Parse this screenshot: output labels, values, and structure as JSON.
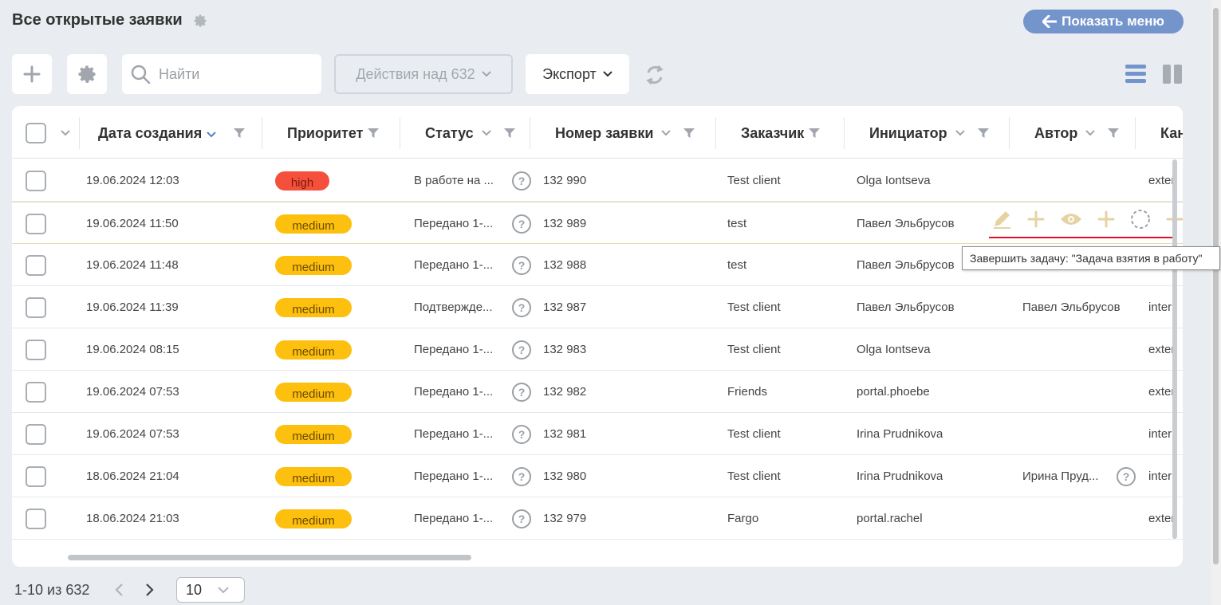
{
  "header": {
    "title": "Все открытые заявки",
    "show_menu_label": "Показать меню"
  },
  "toolbar": {
    "search_placeholder": "Найти",
    "actions_label": "Действия над 632",
    "export_label": "Экспорт"
  },
  "table": {
    "columns": [
      {
        "label": "Дата создания"
      },
      {
        "label": "Приоритет"
      },
      {
        "label": "Статус"
      },
      {
        "label": "Номер заявки"
      },
      {
        "label": "Заказчик"
      },
      {
        "label": "Инициатор"
      },
      {
        "label": "Автор"
      },
      {
        "label": "Кан"
      }
    ],
    "rows": [
      {
        "date": "19.06.2024 12:03",
        "priority": "high",
        "status": "В работе на ...",
        "number": "132 990",
        "client": "Test client",
        "initiator": "Olga Iontseva",
        "author": "",
        "channel": "exter"
      },
      {
        "date": "19.06.2024 11:50",
        "priority": "medium",
        "status": "Передано 1-...",
        "number": "132 989",
        "client": "test",
        "initiator": "Павел Эльбрусов",
        "author": "",
        "channel": ""
      },
      {
        "date": "19.06.2024 11:48",
        "priority": "medium",
        "status": "Передано 1-...",
        "number": "132 988",
        "client": "test",
        "initiator": "Павел Эльбрусов",
        "author": "",
        "channel": ""
      },
      {
        "date": "19.06.2024 11:39",
        "priority": "medium",
        "status": "Подтвержде...",
        "number": "132 987",
        "client": "Test client",
        "initiator": "Павел Эльбрусов",
        "author": "Павел Эльбрусов",
        "channel": "interr"
      },
      {
        "date": "19.06.2024 08:15",
        "priority": "medium",
        "status": "Передано 1-...",
        "number": "132 983",
        "client": "Test client",
        "initiator": "Olga Iontseva",
        "author": "",
        "channel": "exter"
      },
      {
        "date": "19.06.2024 07:53",
        "priority": "medium",
        "status": "Передано 1-...",
        "number": "132 982",
        "client": "Friends",
        "initiator": "portal.phoebe",
        "author": "",
        "channel": "exter"
      },
      {
        "date": "19.06.2024 07:53",
        "priority": "medium",
        "status": "Передано 1-...",
        "number": "132 981",
        "client": "Test client",
        "initiator": "Irina Prudnikova",
        "author": "",
        "channel": "interr"
      },
      {
        "date": "18.06.2024 21:04",
        "priority": "medium",
        "status": "Передано 1-...",
        "number": "132 980",
        "client": "Test client",
        "initiator": "Irina Prudnikova",
        "author": "Ирина Пруд...",
        "channel": "interr"
      },
      {
        "date": "18.06.2024 21:03",
        "priority": "medium",
        "status": "Передано 1-...",
        "number": "132 979",
        "client": "Fargo",
        "initiator": "portal.rachel",
        "author": "",
        "channel": "exter"
      }
    ]
  },
  "tooltip": {
    "text": "Завершить задачу: \"Задача взятия в работу\""
  },
  "footer": {
    "range": "1-10 из 632",
    "per_page": "10"
  },
  "colors": {
    "accent": "#7494cc",
    "high": "#f5503b",
    "medium": "#fdc00f",
    "row_action": "#e6d3a3",
    "underline": "#e0102a"
  }
}
